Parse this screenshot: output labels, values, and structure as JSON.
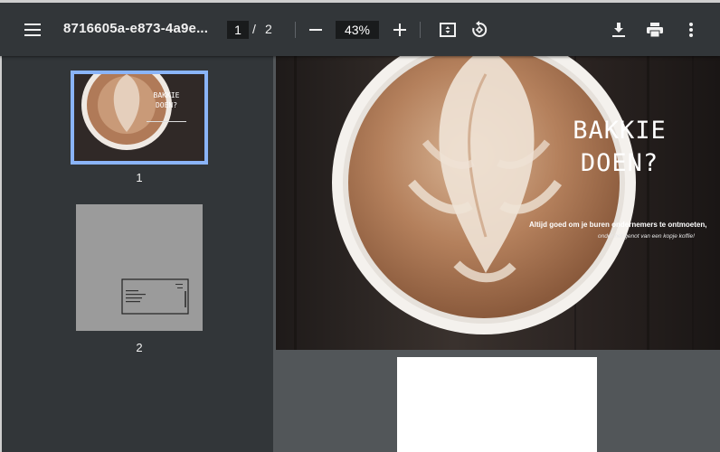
{
  "toolbar": {
    "menu_icon": "hamburger-menu-icon",
    "file_title": "8716605a-e873-4a9e...",
    "current_page": "1",
    "page_separator": "/",
    "total_pages": "2",
    "zoom_out_icon": "minus-icon",
    "zoom_level": "43%",
    "zoom_in_icon": "plus-icon",
    "fit_icon": "fit-to-page-icon",
    "rotate_icon": "rotate-icon",
    "download_icon": "download-icon",
    "print_icon": "print-icon",
    "more_icon": "more-vertical-icon"
  },
  "sidebar": {
    "thumbnails": [
      {
        "label": "1",
        "selected": true
      },
      {
        "label": "2",
        "selected": false
      }
    ],
    "selected_border_color": "#8ab4f8"
  },
  "page1": {
    "title_line1": "BAKKIE",
    "title_line2": "DOEN?",
    "subtitle": "Altijd goed om je buren ondernemers te ontmoeten,",
    "subtitle2": "onder het genot van een kopje koffie!"
  },
  "colors": {
    "toolbar_bg": "#323639",
    "viewer_bg": "#525659",
    "accent": "#8ab4f8"
  }
}
